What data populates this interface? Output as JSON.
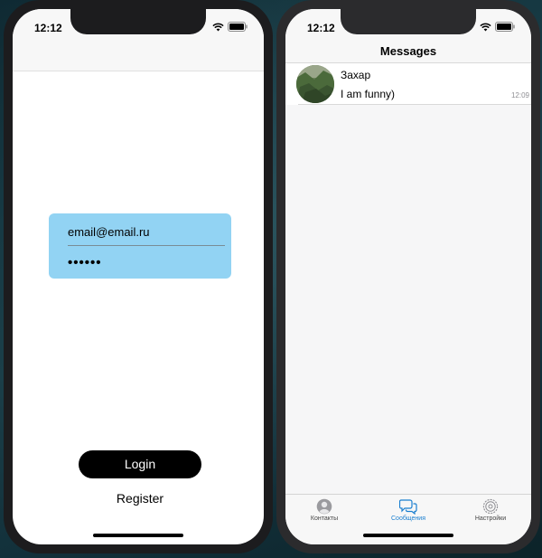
{
  "colors": {
    "accent": "#1a7fd0",
    "login_card": "#92d3f3",
    "login_button": "#000000"
  },
  "left_phone": {
    "status": {
      "time": "12:12"
    },
    "login": {
      "email_value": "email@email.ru",
      "password_value": "••••••",
      "login_label": "Login",
      "register_label": "Register"
    }
  },
  "right_phone": {
    "status": {
      "time": "12:12"
    },
    "title": "Messages",
    "chats": [
      {
        "name": "Захар",
        "last_message": "I am funny)",
        "time": "12:09",
        "avatar_icon": "contact-photo"
      }
    ],
    "tabs": [
      {
        "label": "Контакты",
        "icon": "person-icon",
        "active": false
      },
      {
        "label": "Сообщения",
        "icon": "chat-bubbles-icon",
        "active": true
      },
      {
        "label": "Настройки",
        "icon": "gear-icon",
        "active": false
      }
    ]
  }
}
